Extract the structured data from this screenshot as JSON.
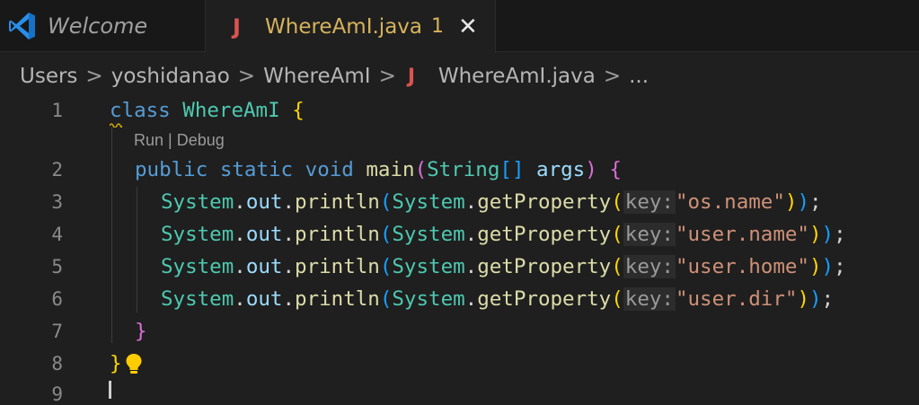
{
  "tabs": {
    "welcome": {
      "label": "Welcome",
      "icon": "vscode-logo-icon"
    },
    "file": {
      "icon_text": "J",
      "label": "WhereAmI.java",
      "badge": "1"
    }
  },
  "breadcrumb": {
    "items": [
      "Users",
      "yoshidanao",
      "WhereAmI"
    ],
    "file_icon_text": "J",
    "file": "WhereAmI.java",
    "more": "...",
    "separator": ">"
  },
  "codelens": "Run | Debug",
  "gutter": [
    "1",
    "2",
    "3",
    "4",
    "5",
    "6",
    "7",
    "8",
    "9"
  ],
  "code": {
    "kw_class": "class",
    "class_name": "WhereAmI",
    "kw_public": "public",
    "kw_static": "static",
    "kw_void": "void",
    "method_main": "main",
    "type_string": "String",
    "array_brackets": "[]",
    "param_args": "args",
    "system": "System",
    "out": "out",
    "println": "println",
    "getProperty": "getProperty",
    "hint_key": "key:",
    "strings": [
      "\"os.name\"",
      "\"user.name\"",
      "\"user.home\"",
      "\"user.dir\""
    ],
    "open_brace": "{",
    "close_brace": "}",
    "open_paren": "(",
    "close_paren": ")",
    "dot": ".",
    "semicolon": ";"
  },
  "colors": {
    "background": "#1f1f1f",
    "tab_bar": "#181818",
    "keyword": "#569cd6",
    "type": "#4ec9b0",
    "function": "#dcdcaa",
    "string": "#ce9178",
    "variable": "#9cdcfe",
    "warning_tab_text": "#d6b35c",
    "java_icon": "#d9534f"
  }
}
